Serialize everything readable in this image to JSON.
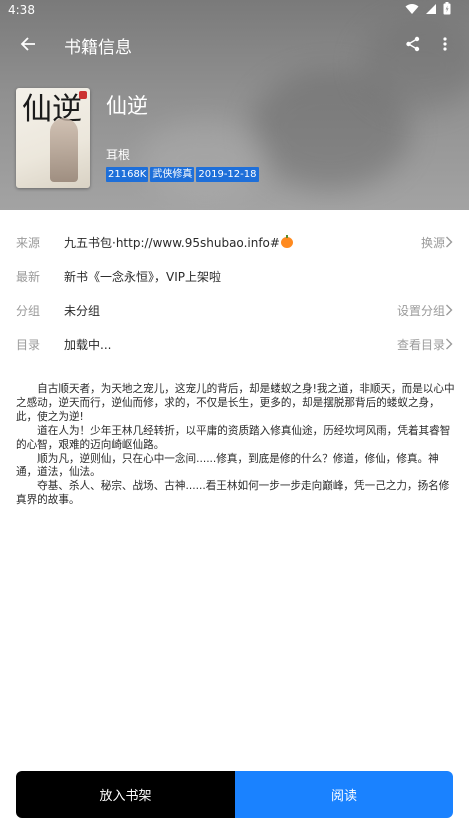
{
  "status_bar": {
    "time": "4:38"
  },
  "app_bar": {
    "title": "书籍信息"
  },
  "book": {
    "title": "仙逆",
    "author": "耳根",
    "tags": [
      "21168K",
      "武侠修真",
      "2019-12-18"
    ],
    "cover_text": "仙逆"
  },
  "info": {
    "source": {
      "label": "来源",
      "value": "九五书包·http://www.95shubao.info#",
      "action": "换源"
    },
    "latest": {
      "label": "最新",
      "value": "新书《一念永恒》，VIP上架啦"
    },
    "group": {
      "label": "分组",
      "value": "未分组",
      "action": "设置分组"
    },
    "toc": {
      "label": "目录",
      "value": "加载中...",
      "action": "查看目录"
    }
  },
  "intro": "　　自古顺天者，为天地之宠儿，这宠儿的背后，却是蝼蚁之身!我之道，非顺天，而是以心中之感动，逆天而行，逆仙而修，求的，不仅是长生，更多的，却是摆脱那背后的蝼蚁之身，此，使之为逆!\n　　道在人为！少年王林几经转折，以平庸的资质踏入修真仙途，历经坎坷风雨，凭着其睿智的心智，艰难的迈向崎岖仙路。\n　　顺为凡，逆则仙，只在心中一念间......修真，到底是修的什么？修道，修仙，修真。神通，道法，仙法。\n　　夺基、杀人、秘宗、战场、古神......看王林如何一步一步走向巅峰，凭一己之力，扬名修真界的故事。",
  "buttons": {
    "add_shelf": "放入书架",
    "read": "阅读"
  },
  "colors": {
    "read_button": "#1a82ff",
    "shelf_button": "#000000",
    "tag_bg": "#1e6fd9"
  }
}
